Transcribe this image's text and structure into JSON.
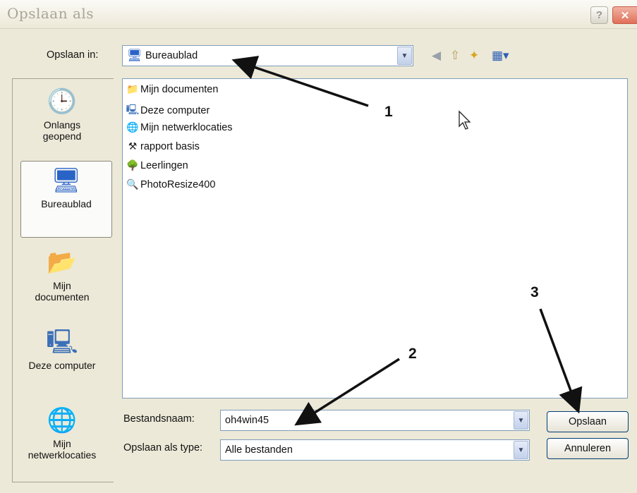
{
  "window": {
    "title": "Opslaan als",
    "help_label": "?",
    "close_label": "✕"
  },
  "save_in": {
    "label": "Opslaan in:",
    "value": "Bureaublad"
  },
  "places": [
    {
      "label_line1": "Onlangs",
      "label_line2": "geopend",
      "icon": "recent-clock-icon"
    },
    {
      "label_line1": "Bureaublad",
      "label_line2": "",
      "icon": "desktop-icon"
    },
    {
      "label_line1": "Mijn",
      "label_line2": "documenten",
      "icon": "folder-documents-icon"
    },
    {
      "label_line1": "Deze computer",
      "label_line2": "",
      "icon": "computer-icon"
    },
    {
      "label_line1": "Mijn",
      "label_line2": "netwerklocaties",
      "icon": "network-icon"
    }
  ],
  "files": [
    {
      "name": "Mijn documenten",
      "icon": "documents-folder-icon"
    },
    {
      "name": "Deze computer",
      "icon": "computer-icon"
    },
    {
      "name": "Mijn netwerklocaties",
      "icon": "network-globe-icon"
    },
    {
      "name": "rapport basis",
      "icon": "shortcut-icon"
    },
    {
      "name": "Leerlingen",
      "icon": "tree-shortcut-icon"
    },
    {
      "name": "PhotoResize400",
      "icon": "photo-app-icon"
    }
  ],
  "filename": {
    "label": "Bestandsnaam:",
    "value": "oh4win45"
  },
  "filetype": {
    "label": "Opslaan als type:",
    "value": "Alle bestanden"
  },
  "buttons": {
    "save": "Opslaan",
    "cancel": "Annuleren"
  },
  "annotations": {
    "a1": "1",
    "a2": "2",
    "a3": "3"
  },
  "colors": {
    "dialog_bg": "#ece9d8",
    "border_blue": "#7f9db9",
    "button_border": "#003c74"
  }
}
